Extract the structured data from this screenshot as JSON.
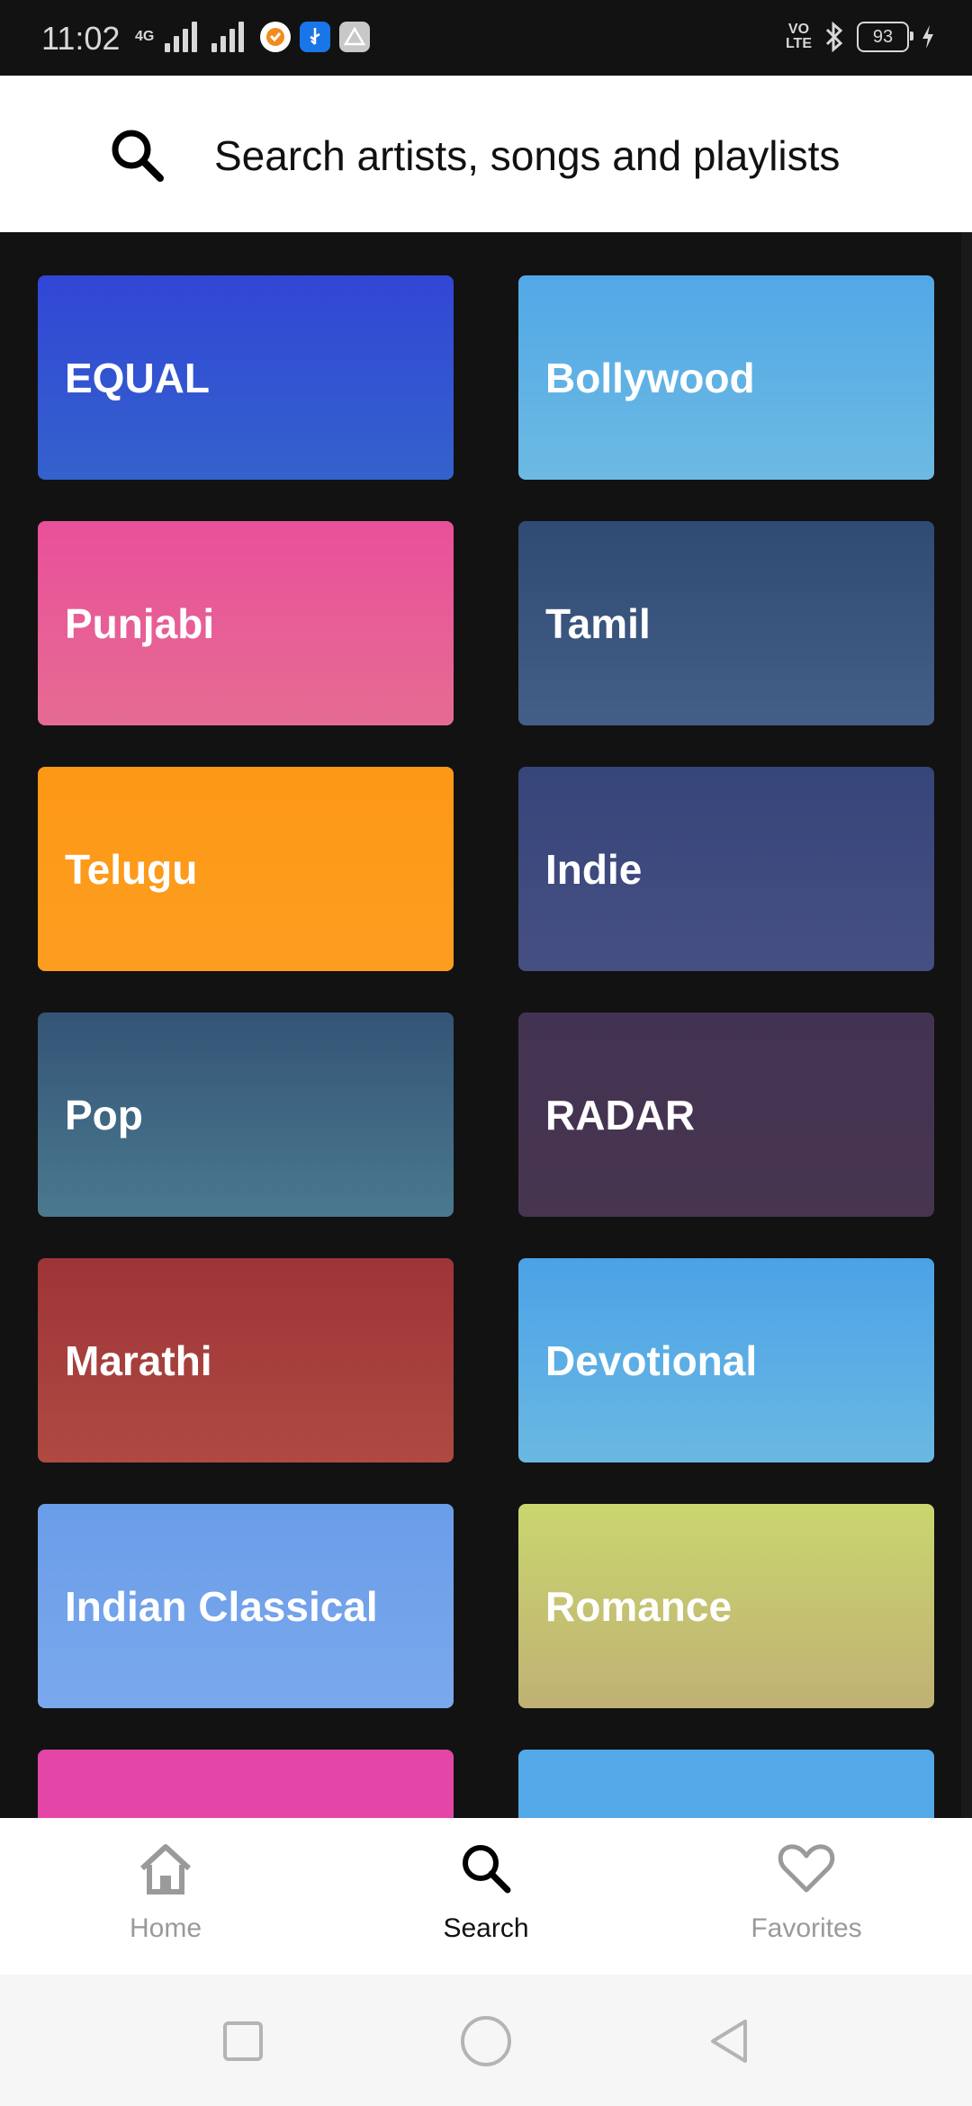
{
  "status_bar": {
    "time": "11:02",
    "network": "4G",
    "volte": [
      "VO",
      "LTE"
    ],
    "battery": "93"
  },
  "search": {
    "placeholder": "Search artists, songs and playlists",
    "icon": "search-icon"
  },
  "categories": [
    {
      "label": "EQUAL",
      "color_top": "#3146d6",
      "color_bottom": "#3462cc"
    },
    {
      "label": "Bollywood",
      "color_top": "#52a8e6",
      "color_bottom": "#6cbae3"
    },
    {
      "label": "Punjabi",
      "color_top": "#e9509a",
      "color_bottom": "#e56b92"
    },
    {
      "label": "Tamil",
      "color_top": "#2f4a73",
      "color_bottom": "#435f88"
    },
    {
      "label": "Telugu",
      "color_top": "#fd9815",
      "color_bottom": "#fd9d20"
    },
    {
      "label": "Indie",
      "color_top": "#36457a",
      "color_bottom": "#464f82"
    },
    {
      "label": "Pop",
      "color_top": "#345476",
      "color_bottom": "#4a798f"
    },
    {
      "label": "RADAR",
      "color_top": "#433353",
      "color_bottom": "#47354f"
    },
    {
      "label": "Marathi",
      "color_top": "#9e3437",
      "color_bottom": "#ae4a42"
    },
    {
      "label": "Devotional",
      "color_top": "#4ba2e6",
      "color_bottom": "#6ab8e2"
    },
    {
      "label": "Indian Classical",
      "color_top": "#6a9de9",
      "color_bottom": "#7aa8ec"
    },
    {
      "label": "Romance",
      "color_top": "#c9d66e",
      "color_bottom": "#c0b175"
    },
    {
      "label": "",
      "color_top": "#e446a7",
      "color_bottom": "#e446a7"
    },
    {
      "label": "",
      "color_top": "#53a9e8",
      "color_bottom": "#53a9e8"
    }
  ],
  "bottom_nav": {
    "items": [
      {
        "label": "Home",
        "icon": "home-icon",
        "active": false
      },
      {
        "label": "Search",
        "icon": "search-icon",
        "active": true
      },
      {
        "label": "Favorites",
        "icon": "heart-icon",
        "active": false
      }
    ]
  },
  "system_nav": {
    "buttons": [
      "recents-icon",
      "home-circle-icon",
      "back-icon"
    ]
  }
}
